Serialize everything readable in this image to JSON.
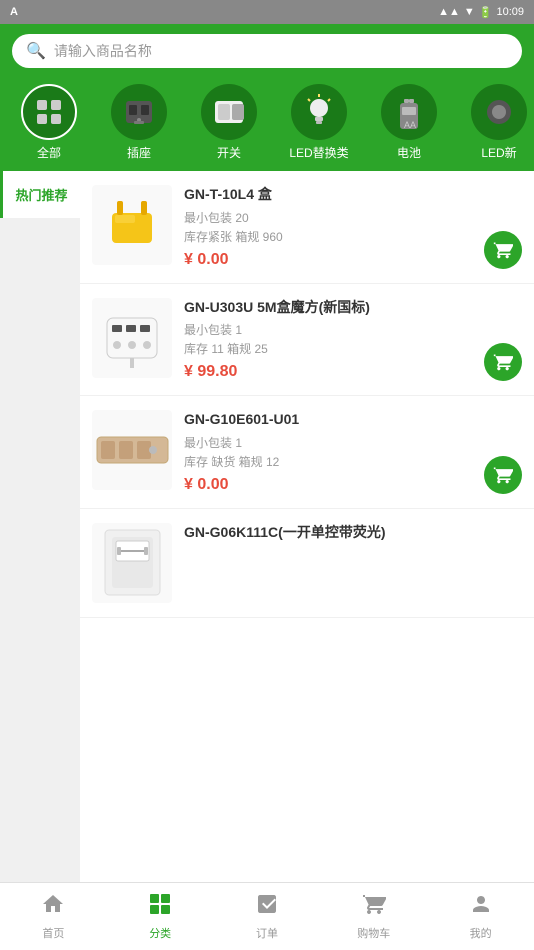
{
  "statusBar": {
    "operator": "A",
    "time": "10:09"
  },
  "header": {
    "searchPlaceholder": "请输入商品名称"
  },
  "categories": [
    {
      "id": "all",
      "label": "全部",
      "active": true
    },
    {
      "id": "socket",
      "label": "插座",
      "active": false
    },
    {
      "id": "switch",
      "label": "开关",
      "active": false
    },
    {
      "id": "led",
      "label": "LED替换类",
      "active": false
    },
    {
      "id": "battery",
      "label": "电池",
      "active": false
    },
    {
      "id": "led2",
      "label": "LED新",
      "active": false
    }
  ],
  "sidebar": {
    "items": [
      {
        "label": "热门推荐",
        "active": true
      }
    ]
  },
  "products": [
    {
      "name": "GN-T-10L4 盒",
      "minPack": "最小包装 20",
      "stock": "库存紧张  箱规 960",
      "price": "¥ 0.00"
    },
    {
      "name": "GN-U303U 5M盒魔方(新国标)",
      "minPack": "最小包装 1",
      "stock": "库存 11  箱规 25",
      "price": "¥ 99.80"
    },
    {
      "name": "GN-G10E601-U01",
      "minPack": "最小包装 1",
      "stock": "库存 缺货  箱规 12",
      "price": "¥ 0.00"
    },
    {
      "name": "GN-G06K111C(一开单控带荧光)",
      "minPack": "",
      "stock": "",
      "price": ""
    }
  ],
  "bottomNav": [
    {
      "label": "首页",
      "active": false
    },
    {
      "label": "分类",
      "active": true
    },
    {
      "label": "订单",
      "active": false
    },
    {
      "label": "购物车",
      "active": false
    },
    {
      "label": "我的",
      "active": false
    }
  ]
}
